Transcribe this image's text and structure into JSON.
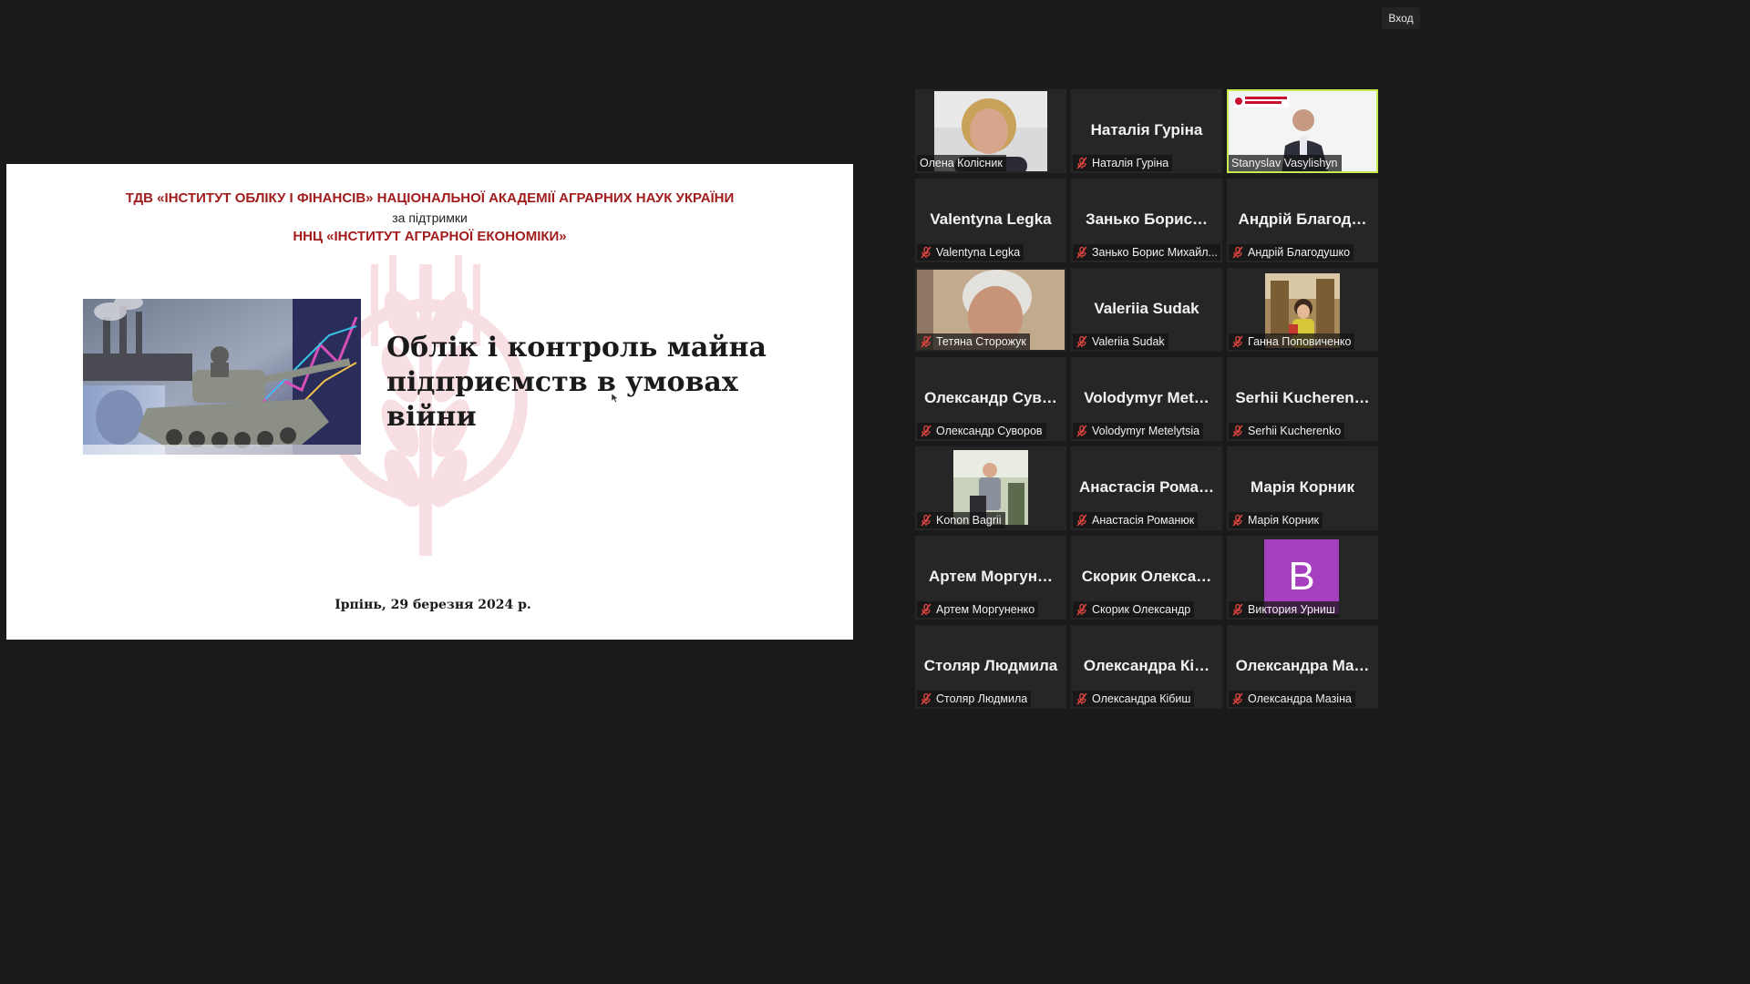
{
  "app": {
    "signin_label": "Вход"
  },
  "slide": {
    "header_line1": "ТДВ «ІНСТИТУТ ОБЛІКУ І ФІНАНСІВ» НАЦІОНАЛЬНОЇ АКАДЕМІЇ АГРАРНИХ НАУК УКРАЇНИ",
    "header_line2": "за підтримки",
    "header_line3": "ННЦ «ІНСТИТУТ АГРАРНОЇ ЕКОНОМІКИ»",
    "title": "Облік і контроль майна\nпідприємств в умовах\nвійни",
    "footer": "Ірпінь, 29 березня 2024 р."
  },
  "participants": [
    {
      "display": "Олена Колісник",
      "label": "Олена Колісник",
      "video": "face-woman-blonde",
      "muted": false,
      "active": false
    },
    {
      "display": "Наталія Гуріна",
      "label": "Наталія Гуріна",
      "video": null,
      "muted": true,
      "active": false
    },
    {
      "display": "Stanyslav Vasylishyn",
      "label": "Stanyslav Vasylishyn",
      "video": "speaker-with-logo",
      "muted": false,
      "active": true
    },
    {
      "display": "Valentyna Legka",
      "label": "Valentyna Legka",
      "video": null,
      "muted": true,
      "active": false
    },
    {
      "display": "Занько Борис…",
      "label": "Занько Борис Михайл...",
      "video": null,
      "muted": true,
      "active": false
    },
    {
      "display": "Андрій Благод…",
      "label": "Андрій Благодушко",
      "video": null,
      "muted": true,
      "active": false
    },
    {
      "display": "Тетяна Сторожук",
      "label": "Тетяна Сторожук",
      "video": "face-elderly-blurred",
      "muted": true,
      "active": false
    },
    {
      "display": "Valeriia Sudak",
      "label": "Valeriia Sudak",
      "video": null,
      "muted": true,
      "active": false
    },
    {
      "display": "Ганна Поповиченко",
      "label": "Ганна Поповиченко",
      "video": "photo-child",
      "muted": true,
      "active": false
    },
    {
      "display": "Олександр Сув…",
      "label": "Олександр Суворов",
      "video": null,
      "muted": true,
      "active": false
    },
    {
      "display": "Volodymyr Met…",
      "label": "Volodymyr Metelytsia",
      "video": null,
      "muted": true,
      "active": false
    },
    {
      "display": "Serhii Kucheren…",
      "label": "Serhii Kucherenko",
      "video": null,
      "muted": true,
      "active": false
    },
    {
      "display": "Konon Bagrii",
      "label": "Konon Bagrii",
      "video": "photo-man-podium",
      "muted": true,
      "active": false
    },
    {
      "display": "Анастасія Рома…",
      "label": "Анастасія Романюк",
      "video": null,
      "muted": true,
      "active": false
    },
    {
      "display": "Марія Корник",
      "label": "Марія Корник",
      "video": null,
      "muted": true,
      "active": false
    },
    {
      "display": "Артем Моргун…",
      "label": "Артем Моргуненко",
      "video": null,
      "muted": true,
      "active": false
    },
    {
      "display": "Скорик Олекса…",
      "label": "Скорик Олександр",
      "video": null,
      "muted": true,
      "active": false
    },
    {
      "display": "B",
      "label": "Виктория Урниш",
      "video": "avatar-letter",
      "avatar_color": "#a63fbf",
      "muted": true,
      "active": false
    },
    {
      "display": "Столяр Людмила",
      "label": "Столяр Людмила",
      "video": null,
      "muted": true,
      "active": false
    },
    {
      "display": "Олександра Кі…",
      "label": "Олександра Кібиш",
      "video": null,
      "muted": true,
      "active": false
    },
    {
      "display": "Олександра Ма…",
      "label": "Олександра Мазіна",
      "video": null,
      "muted": true,
      "active": false
    }
  ],
  "colors": {
    "background": "#1a1a1a",
    "tile": "#262626",
    "active_border": "#c6ea4f",
    "header_red": "#a11d1d",
    "mic_off": "#e0463f"
  }
}
